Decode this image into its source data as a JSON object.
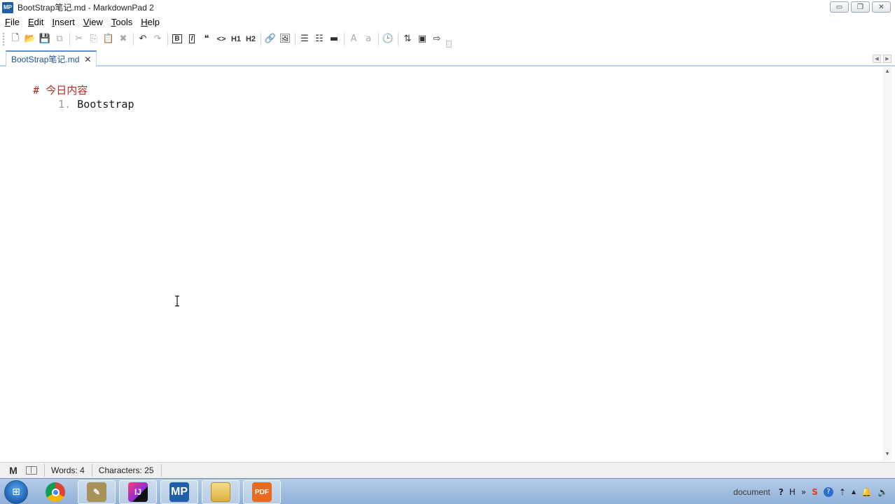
{
  "window": {
    "app_icon_text": "MP",
    "title": "BootStrap笔记.md - MarkdownPad 2",
    "controls": {
      "minimize": "▭",
      "restore": "❐",
      "close": "✕"
    }
  },
  "menu": {
    "items": [
      {
        "label": "File",
        "accel": "F",
        "rest": "ile"
      },
      {
        "label": "Edit",
        "accel": "E",
        "rest": "dit"
      },
      {
        "label": "Insert",
        "accel": "I",
        "rest": "nsert"
      },
      {
        "label": "View",
        "accel": "V",
        "rest": "iew"
      },
      {
        "label": "Tools",
        "accel": "T",
        "rest": "ools"
      },
      {
        "label": "Help",
        "accel": "H",
        "rest": "elp"
      }
    ]
  },
  "toolbar": {
    "new_icon": "🗋",
    "open_icon": "📂",
    "save_icon": "💾",
    "save_all_icon": "⧉",
    "cut_icon": "✂",
    "copy_icon": "⎘",
    "paste_icon": "📋",
    "delete_icon": "✖",
    "undo_icon": "↶",
    "redo_icon": "↷",
    "bold_label": "B",
    "italic_label": "I",
    "quote_icon": "❝",
    "code_icon": "<>",
    "h1_label": "H1",
    "h2_label": "H2",
    "link_icon": "🔗",
    "image_icon": "🖼",
    "ul_icon": "☰",
    "ol_icon": "☷",
    "hr_icon": "▬",
    "upper_label": "A",
    "lower_label": "a",
    "timestamp_icon": "🕒",
    "extra1_icon": "⇅",
    "extra2_icon": "▣",
    "export_icon": "⇨"
  },
  "tabs": {
    "active": {
      "label": "BootStrap笔记.md",
      "close": "✕"
    },
    "nav_left": "◀",
    "nav_right": "▶"
  },
  "editor": {
    "lines": [
      {
        "marker": "#",
        "text": "今日内容"
      },
      {
        "marker": "1.",
        "text": "Bootstrap"
      }
    ],
    "scroll_up": "▲",
    "scroll_down": "▼"
  },
  "status": {
    "markdown_icon": "M",
    "words": "Words: 4",
    "characters": "Characters: 25"
  },
  "taskbar": {
    "start_icon": "⊞",
    "apps": [
      {
        "name": "chrome",
        "label": "",
        "color": "#e05a2b",
        "active": false
      },
      {
        "name": "editor",
        "label": "✎",
        "color": "#8b7a3e",
        "active": true
      },
      {
        "name": "intellij",
        "label": "IJ",
        "color": "#c2185b",
        "active": true
      },
      {
        "name": "markdownpad",
        "label": "MP",
        "color": "#1e5fa8",
        "active": true
      },
      {
        "name": "explorer",
        "label": "",
        "color": "#e7c25a",
        "active": true
      },
      {
        "name": "pdf",
        "label": "PDF",
        "color": "#e86a1e",
        "active": true
      }
    ],
    "tray": {
      "document_label": "document",
      "help_icon": "?",
      "h_label": "H",
      "chevron": "»",
      "sogou_icon": "S",
      "question_icon": "?",
      "network_icon": "⇡",
      "up_arrow": "▲",
      "bell_icon": "🔔",
      "volume_icon": "🔊"
    }
  }
}
